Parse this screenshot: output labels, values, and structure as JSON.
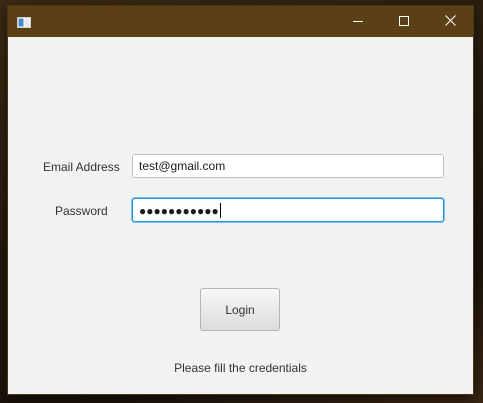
{
  "window": {
    "title": "",
    "titlebar_color": "#5c4015",
    "icons": {
      "app": "app-window-icon",
      "minimize": "minimize-icon",
      "maximize": "maximize-icon",
      "close": "close-icon"
    }
  },
  "form": {
    "email_label": "Email Address",
    "email_value": "test@gmail.com",
    "password_label": "Password",
    "password_masked": "●●●●●●●●●●●",
    "focus_color": "#2a8fd0"
  },
  "actions": {
    "login_label": "Login"
  },
  "status": {
    "message": "Please fill the credentials"
  }
}
